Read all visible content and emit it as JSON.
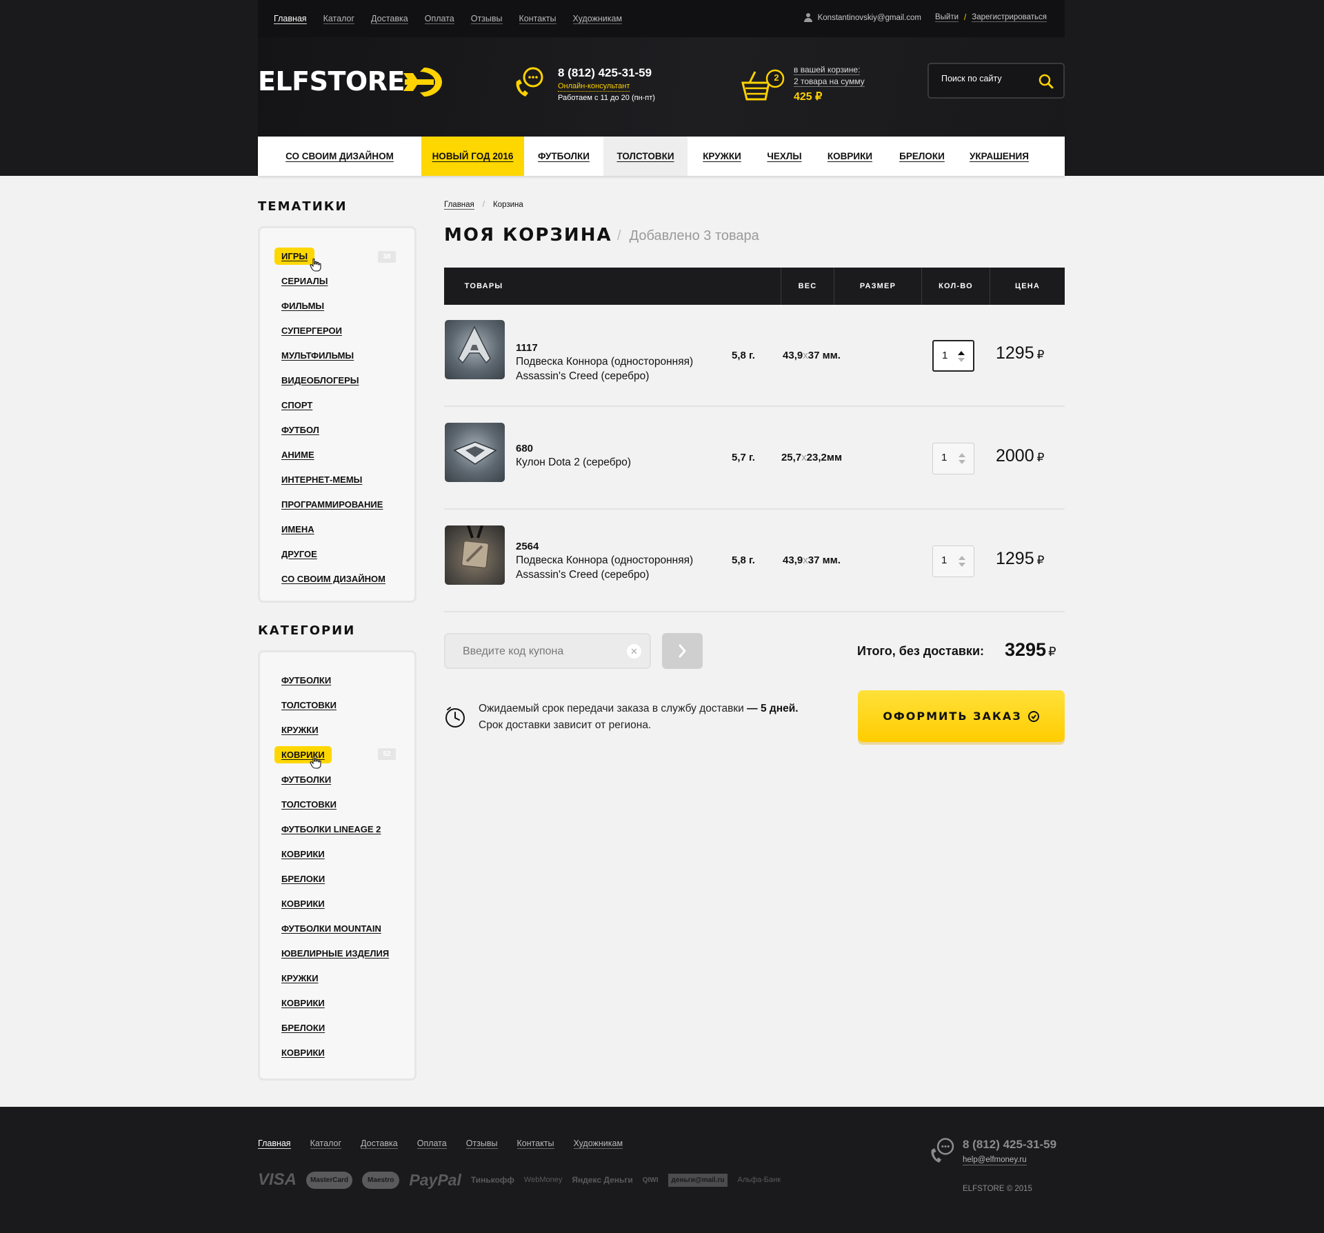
{
  "colors": {
    "accent": "#ffd700",
    "dark": "#1a1a1c",
    "page_bg": "#f2f2f2"
  },
  "topnav": {
    "items": [
      "Главная",
      "Каталог",
      "Доставка",
      "Оплата",
      "Отзывы",
      "Контакты",
      "Художникам"
    ],
    "active_index": 0
  },
  "user": {
    "icon": "user-icon",
    "email": "Konstantinovskiy@gmail.com",
    "logout": "Выйти",
    "separator": "/",
    "register": "Зарегистрироваться"
  },
  "logo": {
    "text": "ELFSTORE",
    "icon": "arrow-logo-icon"
  },
  "contact": {
    "icon": "chat-phone-icon",
    "phone": "8 (812) 425-31-59",
    "consultant": "Онлайн-консультант",
    "hours": "Работаем с 11 до 20 (пн-пт)"
  },
  "cart_summary": {
    "icon": "basket-icon",
    "count_badge": "2",
    "line1": "в вашей корзине:",
    "line2": "2 товара на сумму",
    "sum": "425 ₽"
  },
  "search": {
    "placeholder": "Поиск по сайту",
    "icon": "search-icon"
  },
  "catnav": {
    "items": [
      "СО СВОИМ ДИЗАЙНОМ",
      "НОВЫЙ ГОД 2016",
      "ФУТБОЛКИ",
      "ТОЛСТОВКИ",
      "КРУЖКИ",
      "ЧЕХЛЫ",
      "КОВРИКИ",
      "БРЕЛОКИ",
      "УКРАШЕНИЯ"
    ],
    "highlighted_index": 1,
    "hover_index": 3
  },
  "sidebar": {
    "themes_title": "ТЕМАТИКИ",
    "themes": [
      "ИГРЫ",
      "СЕРИАЛЫ",
      "ФИЛЬМЫ",
      "СУПЕРГЕРОИ",
      "МУЛЬТФИЛЬМЫ",
      "ВИДЕОБЛОГЕРЫ",
      "СПОРТ",
      "ФУТБОЛ",
      "АНИМЕ",
      "ИНТЕРНЕТ-МЕМЫ",
      "ПРОГРАММИРОВАНИЕ",
      "ИМЕНА",
      "ДРУГОЕ",
      "СО СВОИМ ДИЗАЙНОМ"
    ],
    "themes_active_index": 0,
    "themes_active_count": "38",
    "categories_title": "КАТЕГОРИИ",
    "categories": [
      "ФУТБОЛКИ",
      "ТОЛСТОВКИ",
      "КРУЖКИ",
      "КОВРИКИ",
      "ФУТБОЛКИ",
      "ТОЛСТОВКИ",
      "ФУТБОЛКИ LINEAGE 2",
      "КОВРИКИ",
      "БРЕЛОКИ",
      "КОВРИКИ",
      "ФУТБОЛКИ MOUNTAIN",
      "ЮВЕЛИРНЫЕ ИЗДЕЛИЯ",
      "КРУЖКИ",
      "КОВРИКИ",
      "БРЕЛОКИ",
      "КОВРИКИ"
    ],
    "categories_active_index": 3,
    "categories_active_count": "52"
  },
  "breadcrumb": {
    "home": "Главная",
    "separator": "/",
    "current": "Корзина"
  },
  "page": {
    "title": "МОЯ КОРЗИНА",
    "separator": "/",
    "subtitle": "Добавлено 3 товара"
  },
  "cart_table": {
    "headers": {
      "products": "ТОВАРЫ",
      "weight": "ВЕС",
      "size": "РАЗМЕР",
      "qty": "КОЛ-ВО",
      "price": "ЦЕНА"
    },
    "currency": "₽",
    "size_separator": "x",
    "rows": [
      {
        "sku": "1117",
        "name": "Подвеска Коннора (односторонняя) Assassin's Creed (серебро)",
        "weight": "5,8 г.",
        "size_a": "43,9",
        "size_b": "37 мм.",
        "qty": "1",
        "price": "1295",
        "image": "assassins-creed-pendant-image"
      },
      {
        "sku": "680",
        "name": "Кулон Dota 2 (серебро)",
        "weight": "5,7 г.",
        "size_a": "25,7",
        "size_b": "23,2мм",
        "qty": "1",
        "price": "2000",
        "image": "dota-pendant-image"
      },
      {
        "sku": "2564",
        "name": "Подвеска Коннора (односторонняя) Assassin's Creed (серебро)",
        "weight": "5,8 г.",
        "size_a": "43,9",
        "size_b": "37 мм.",
        "qty": "1",
        "price": "1295",
        "image": "dota-square-pendant-image"
      }
    ]
  },
  "coupon": {
    "placeholder": "Введите код купона",
    "clear_icon": "close-icon",
    "submit_icon": "chevron-right-icon"
  },
  "total": {
    "label": "Итого, без доставки:",
    "value": "3295",
    "currency": "₽"
  },
  "delivery": {
    "icon": "clock-icon",
    "line1_prefix": "Ожидаемый срок передачи заказа в службу доставки ",
    "line1_bold": "— 5 дней.",
    "line2": "Срок доставки зависит от региона."
  },
  "order_button": {
    "label": "ОФОРМИТЬ ЗАКАЗ",
    "icon": "check-circle-icon"
  },
  "footer": {
    "nav": [
      "Главная",
      "Каталог",
      "Доставка",
      "Оплата",
      "Отзывы",
      "Контакты",
      "Художникам"
    ],
    "active_index": 0,
    "payments": [
      "VISA",
      "MasterCard",
      "Maestro",
      "PayPal",
      "Тинькофф",
      "WebMoney",
      "Яндекс Деньги",
      "QIWI",
      "деньги@mail.ru",
      "Альфа-Банк"
    ],
    "phone": "8 (812) 425-31-59",
    "email": "help@elfmoney.ru",
    "copyright": "ELFSTORE © 2015"
  }
}
